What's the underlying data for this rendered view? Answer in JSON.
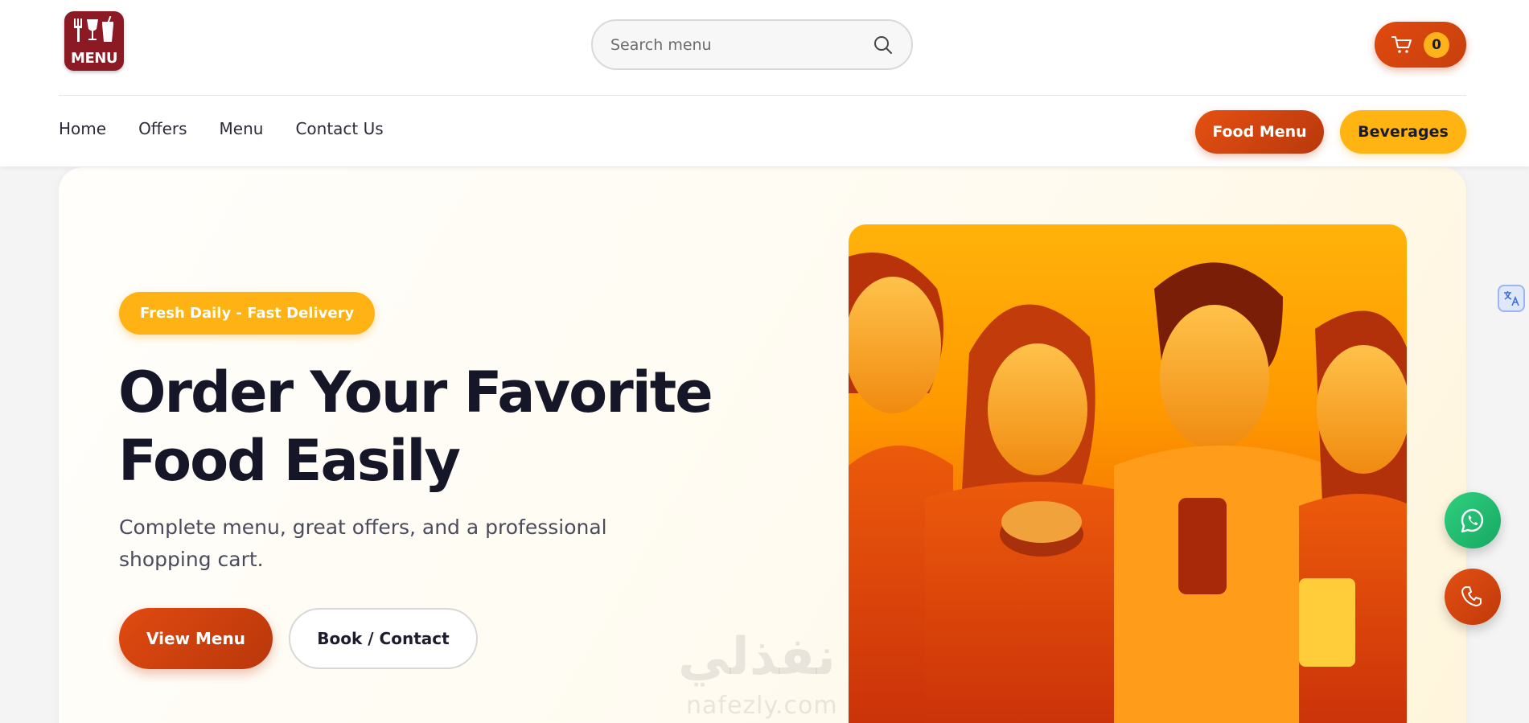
{
  "header": {
    "logo_text": "MENU",
    "search": {
      "placeholder": "Search menu"
    },
    "cart": {
      "count": "0"
    }
  },
  "nav": {
    "items": [
      {
        "label": "Home"
      },
      {
        "label": "Offers"
      },
      {
        "label": "Menu"
      },
      {
        "label": "Contact Us"
      }
    ],
    "food_menu_label": "Food Menu",
    "beverages_label": "Beverages"
  },
  "hero": {
    "badge": "Fresh Daily - Fast Delivery",
    "title_line1": "Order Your Favorite",
    "title_line2": "Food Easily",
    "subtitle": "Complete menu, great offers, and a professional shopping cart.",
    "view_menu_label": "View Menu",
    "book_contact_label": "Book / Contact"
  },
  "watermark": {
    "arabic": "نفذلي",
    "latin": "nafezly.com"
  },
  "colors": {
    "brand_orange": "#e04a10",
    "brand_yellow": "#ffb414",
    "logo_maroon": "#8b1a25",
    "whatsapp_green": "#1fbf6f"
  },
  "icons": {
    "logo": "fork-wine-cup-icon",
    "search": "search-icon",
    "cart": "cart-icon",
    "translate": "translate-icon",
    "whatsapp": "whatsapp-icon",
    "phone": "phone-icon"
  }
}
